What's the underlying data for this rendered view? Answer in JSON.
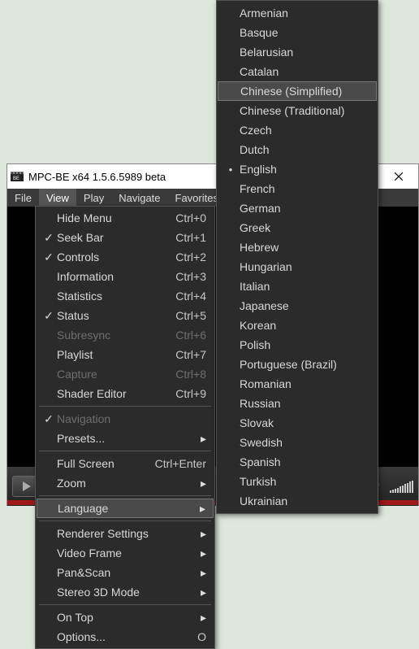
{
  "window": {
    "title": "MPC-BE x64 1.5.6.5989 beta"
  },
  "menubar": {
    "items": [
      "File",
      "View",
      "Play",
      "Navigate",
      "Favorites"
    ],
    "active_index": 1
  },
  "view_menu": {
    "items": [
      {
        "label": "Hide Menu",
        "shortcut": "Ctrl+0",
        "checked": false,
        "disabled": false
      },
      {
        "label": "Seek Bar",
        "shortcut": "Ctrl+1",
        "checked": true,
        "disabled": false
      },
      {
        "label": "Controls",
        "shortcut": "Ctrl+2",
        "checked": true,
        "disabled": false
      },
      {
        "label": "Information",
        "shortcut": "Ctrl+3",
        "checked": false,
        "disabled": false
      },
      {
        "label": "Statistics",
        "shortcut": "Ctrl+4",
        "checked": false,
        "disabled": false
      },
      {
        "label": "Status",
        "shortcut": "Ctrl+5",
        "checked": true,
        "disabled": false
      },
      {
        "label": "Subresync",
        "shortcut": "Ctrl+6",
        "checked": false,
        "disabled": true
      },
      {
        "label": "Playlist",
        "shortcut": "Ctrl+7",
        "checked": false,
        "disabled": false
      },
      {
        "label": "Capture",
        "shortcut": "Ctrl+8",
        "checked": false,
        "disabled": true
      },
      {
        "label": "Shader Editor",
        "shortcut": "Ctrl+9",
        "checked": false,
        "disabled": false
      },
      {
        "sep": true
      },
      {
        "label": "Navigation",
        "shortcut": "",
        "checked": true,
        "disabled": true
      },
      {
        "label": "Presets...",
        "shortcut": "",
        "submenu": true
      },
      {
        "sep": true
      },
      {
        "label": "Full Screen",
        "shortcut": "Ctrl+Enter"
      },
      {
        "label": "Zoom",
        "shortcut": "",
        "submenu": true
      },
      {
        "sep": true
      },
      {
        "label": "Language",
        "shortcut": "",
        "submenu": true,
        "highlight": true
      },
      {
        "sep": true
      },
      {
        "label": "Renderer Settings",
        "shortcut": "",
        "submenu": true
      },
      {
        "label": "Video Frame",
        "shortcut": "",
        "submenu": true
      },
      {
        "label": "Pan&Scan",
        "shortcut": "",
        "submenu": true
      },
      {
        "label": "Stereo 3D Mode",
        "shortcut": "",
        "submenu": true
      },
      {
        "sep": true
      },
      {
        "label": "On Top",
        "shortcut": "",
        "submenu": true
      },
      {
        "label": "Options...",
        "shortcut": "O"
      }
    ]
  },
  "language_menu": {
    "items": [
      {
        "label": "Armenian"
      },
      {
        "label": "Basque"
      },
      {
        "label": "Belarusian"
      },
      {
        "label": "Catalan"
      },
      {
        "label": "Chinese (Simplified)",
        "highlight": true
      },
      {
        "label": "Chinese (Traditional)"
      },
      {
        "label": "Czech"
      },
      {
        "label": "Dutch"
      },
      {
        "label": "English",
        "selected": true
      },
      {
        "label": "French"
      },
      {
        "label": "German"
      },
      {
        "label": "Greek"
      },
      {
        "label": "Hebrew"
      },
      {
        "label": "Hungarian"
      },
      {
        "label": "Italian"
      },
      {
        "label": "Japanese"
      },
      {
        "label": "Korean"
      },
      {
        "label": "Polish"
      },
      {
        "label": "Portuguese (Brazil)"
      },
      {
        "label": "Romanian"
      },
      {
        "label": "Russian"
      },
      {
        "label": "Slovak"
      },
      {
        "label": "Swedish"
      },
      {
        "label": "Spanish"
      },
      {
        "label": "Turkish"
      },
      {
        "label": "Ukrainian"
      }
    ]
  }
}
